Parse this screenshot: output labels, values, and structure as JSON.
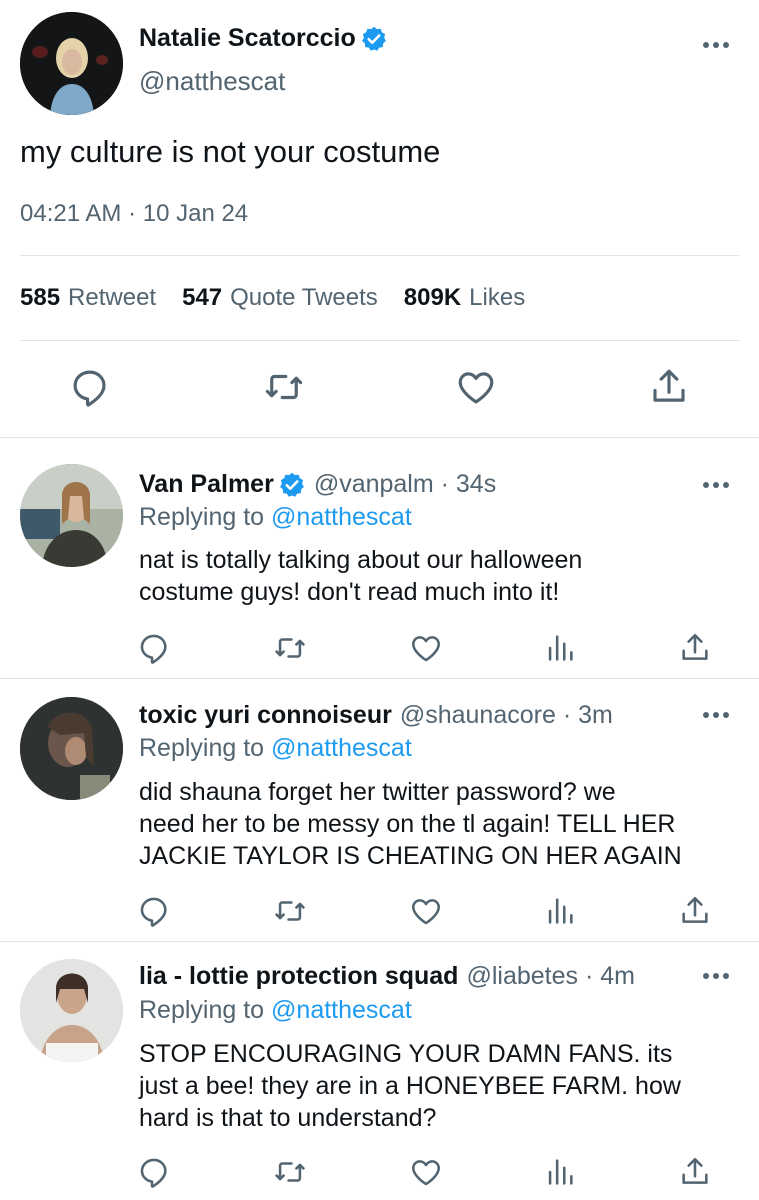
{
  "main_tweet": {
    "author_name": "Natalie Scatorccio",
    "author_handle": "@natthescat",
    "text": "my culture is not your costume",
    "timestamp": "04:21 AM · 10 Jan 24",
    "stats": {
      "retweets_count": "585",
      "retweets_label": "Retweet",
      "quotes_count": "547",
      "quotes_label": "Quote Tweets",
      "likes_count": "809K",
      "likes_label": "Likes"
    },
    "actions": [
      "reply-icon",
      "retweet-icon",
      "like-icon",
      "share-icon"
    ]
  },
  "replies": [
    {
      "name": "Van Palmer",
      "verified": true,
      "handle_time": "@vanpalm · 34s",
      "replying_label": "Replying to",
      "replying_to": "@natthescat",
      "text_lines": [
        "nat is totally talking about our halloween",
        "costume guys! don't read much into it!"
      ]
    },
    {
      "name": "toxic yuri connoiseur",
      "verified": false,
      "handle_time": "@shaunacore · 3m",
      "replying_label": "Replying to",
      "replying_to": "@natthescat",
      "text_lines": [
        "did shauna forget her twitter password? we",
        "need her to be messy on the tl again! TELL HER",
        "JACKIE TAYLOR IS CHEATING ON HER AGAIN"
      ]
    },
    {
      "name": "lia - lottie protection squad",
      "verified": false,
      "handle_time": "@liabetes · 4m",
      "replying_label": "Replying to",
      "replying_to": "@natthescat",
      "text_lines": [
        "STOP ENCOURAGING YOUR DAMN FANS. its",
        "just a bee! they are in a HONEYBEE FARM. how",
        "hard is that to understand?"
      ]
    }
  ],
  "colors": {
    "text": "#0f1419",
    "secondary": "#536471",
    "accent": "#1d9bf0",
    "divider": "#dfe3e6"
  }
}
